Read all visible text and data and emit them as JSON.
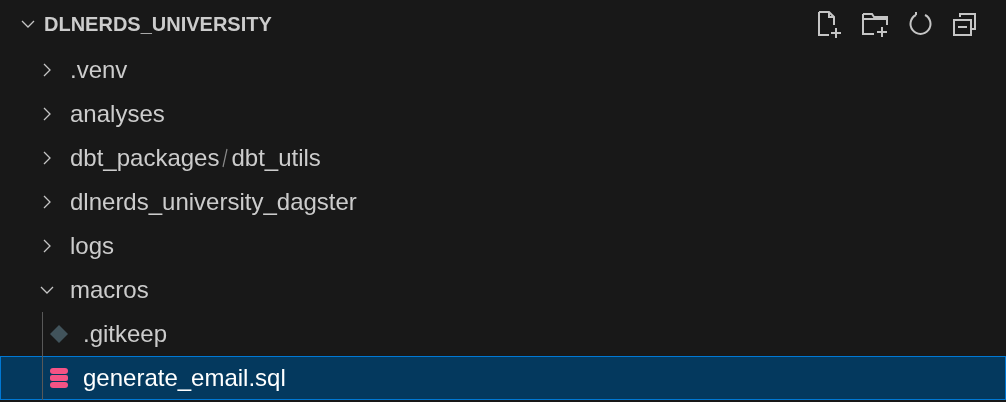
{
  "explorer": {
    "title": "DLNERDS_UNIVERSITY",
    "expanded": true,
    "toolbar": [
      {
        "kind": "new-file"
      },
      {
        "kind": "new-folder"
      },
      {
        "kind": "refresh"
      },
      {
        "kind": "collapse"
      }
    ],
    "tree": [
      {
        "kind": "folder",
        "segments": [
          ".venv"
        ],
        "expanded": false,
        "selected": false
      },
      {
        "kind": "folder",
        "segments": [
          "analyses"
        ],
        "expanded": false,
        "selected": false
      },
      {
        "kind": "folder",
        "segments": [
          "dbt_packages",
          "dbt_utils"
        ],
        "expanded": false,
        "selected": false
      },
      {
        "kind": "folder",
        "segments": [
          "dlnerds_university_dagster"
        ],
        "expanded": false,
        "selected": false
      },
      {
        "kind": "folder",
        "segments": [
          "logs"
        ],
        "expanded": false,
        "selected": false
      },
      {
        "kind": "folder",
        "segments": [
          "macros"
        ],
        "expanded": true,
        "selected": false,
        "children": [
          {
            "kind": "git",
            "segments": [
              ".gitkeep"
            ],
            "selected": false
          },
          {
            "kind": "database",
            "segments": [
              "generate_email.sql"
            ],
            "selected": true
          }
        ]
      }
    ]
  }
}
